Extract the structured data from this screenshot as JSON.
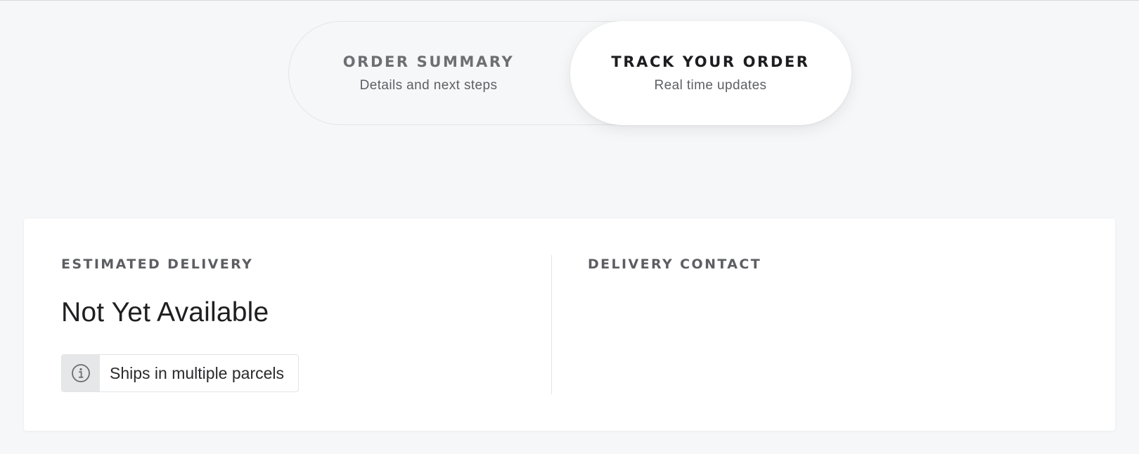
{
  "tabs": {
    "summary": {
      "title": "ORDER SUMMARY",
      "subtitle": "Details and next steps"
    },
    "track": {
      "title": "TRACK YOUR ORDER",
      "subtitle": "Real time updates"
    },
    "active": "track"
  },
  "delivery": {
    "estimated": {
      "label": "ESTIMATED DELIVERY",
      "value": "Not Yet Available",
      "note_icon": "info-icon",
      "note": "Ships in multiple parcels"
    },
    "contact": {
      "label": "DELIVERY CONTACT"
    }
  },
  "colors": {
    "background": "#f6f7f9",
    "card": "#ffffff",
    "active_tab": "#ffffff",
    "label": "#5d5e63",
    "text": "#1f1f21"
  }
}
